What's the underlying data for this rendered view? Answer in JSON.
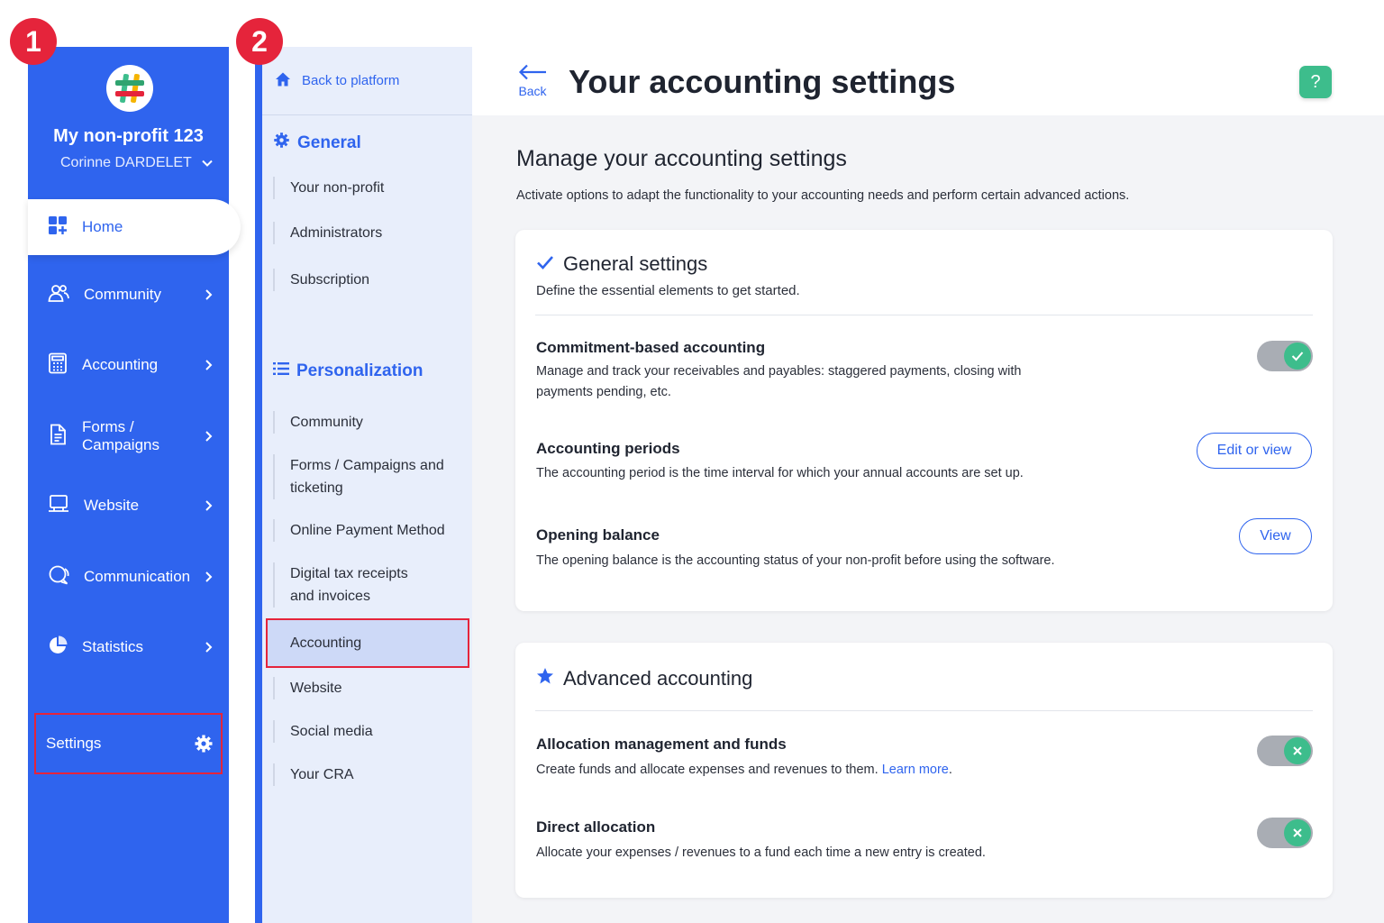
{
  "annotations": {
    "badge_1": "1",
    "badge_2": "2"
  },
  "org": {
    "name": "My non-profit 123",
    "user": "Corinne DARDELET"
  },
  "main_nav": {
    "home": "Home",
    "items": [
      {
        "label": "Community",
        "icon": "community-icon"
      },
      {
        "label": "Accounting",
        "icon": "calculator-icon"
      },
      {
        "label": "Forms / Campaigns",
        "icon": "document-icon"
      },
      {
        "label": "Website",
        "icon": "laptop-icon"
      },
      {
        "label": "Communication",
        "icon": "chat-icon"
      },
      {
        "label": "Statistics",
        "icon": "pie-chart-icon"
      }
    ],
    "settings": "Settings"
  },
  "settings_nav": {
    "back": "Back to platform",
    "general": {
      "title": "General",
      "items": [
        "Your non-profit",
        "Administrators",
        "Subscription"
      ]
    },
    "personalization": {
      "title": "Personalization",
      "items": [
        "Community",
        "Forms / Campaigns and ticketing",
        "Online Payment Method",
        "Digital tax receipts and invoices",
        "Accounting",
        "Website",
        "Social media",
        "Your CRA"
      ]
    }
  },
  "header": {
    "back": "Back",
    "title": "Your accounting settings",
    "help": "?"
  },
  "main": {
    "title": "Manage your accounting settings",
    "description": "Activate options to adapt the functionality to your accounting needs and perform certain advanced actions.",
    "general_card": {
      "title": "General settings",
      "subtitle": "Define the essential elements to get started.",
      "rows": [
        {
          "title": "Commitment-based accounting",
          "desc": "Manage and track your receivables and payables: staggered payments, closing with payments pending, etc.",
          "toggle": "on"
        },
        {
          "title": "Accounting periods",
          "desc": "The accounting period is the time interval for which your annual accounts are set up.",
          "button": "Edit or view"
        },
        {
          "title": "Opening balance",
          "desc": "The opening balance is the accounting status of your non-profit before using the software.",
          "button": "View"
        }
      ]
    },
    "advanced_card": {
      "title": "Advanced accounting",
      "rows": [
        {
          "title": "Allocation management and funds",
          "desc": "Create funds and allocate expenses and revenues to them.",
          "link": "Learn more",
          "toggle": "off"
        },
        {
          "title": "Direct allocation",
          "desc": "Allocate your expenses / revenues to a fund each time a new entry is created.",
          "toggle": "off"
        }
      ]
    }
  },
  "colors": {
    "primary": "#2f64ee",
    "success": "#3dbd8c",
    "highlight": "#e5243b",
    "toggle_track": "#a9adb4"
  }
}
